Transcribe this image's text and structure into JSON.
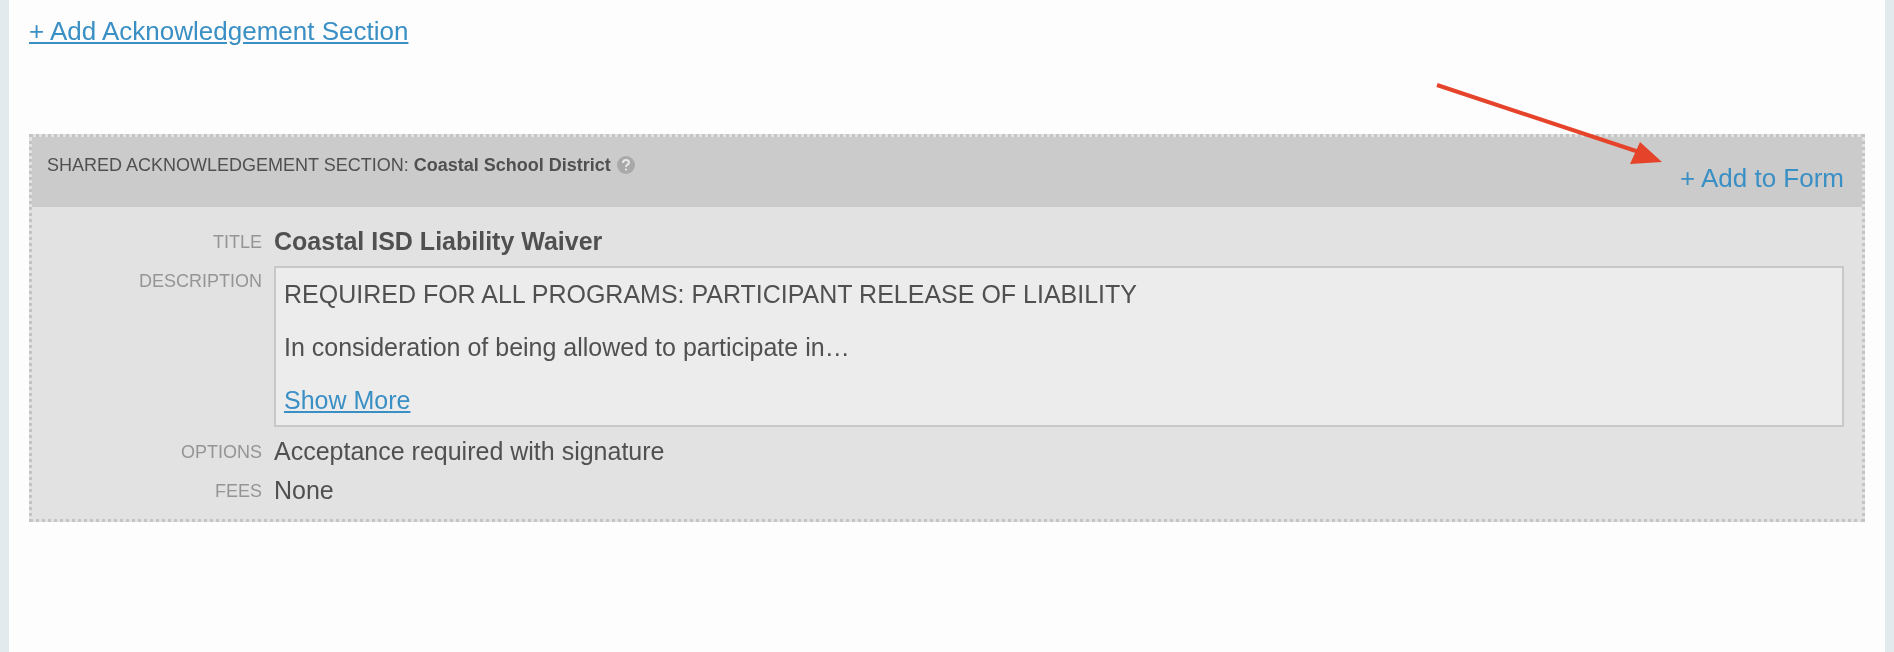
{
  "add_section_link": "+ Add Acknowledgement Section",
  "section": {
    "heading_label": "SHARED ACKNOWLEDGEMENT SECTION:",
    "heading_name": "Coastal School District",
    "add_link": "+ Add to Form",
    "fields": [
      {
        "kind": "title",
        "label": "TITLE",
        "value": "Coastal ISD Liability Waiver"
      },
      {
        "kind": "description",
        "label": "DESCRIPTION",
        "paragraphs": [
          "REQUIRED FOR ALL PROGRAMS: PARTICIPANT RELEASE OF LIABILITY",
          "In consideration of being allowed to participate in…"
        ],
        "more_link": "Show More"
      },
      {
        "kind": "text",
        "label": "OPTIONS",
        "value": "Acceptance required with signature"
      },
      {
        "kind": "text",
        "label": "FEES",
        "value": "None"
      }
    ]
  }
}
